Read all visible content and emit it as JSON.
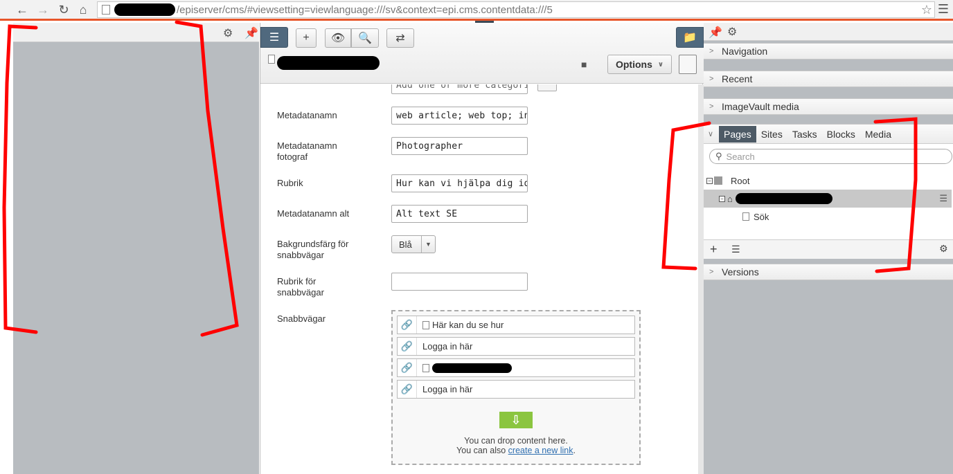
{
  "browser": {
    "url_text": "/episerver/cms/#viewsetting=viewlanguage:///sv&context=epi.cms.contentdata:///5",
    "back_icon": "arrow-left-icon",
    "forward_icon": "arrow-right-icon",
    "reload_icon": "reload-icon",
    "home_icon": "home-icon"
  },
  "left_pane": {
    "settings_icon": "gear-icon",
    "pin_icon": "pin-icon"
  },
  "editor": {
    "options_label": "Options",
    "form": {
      "category_placeholder": "Add one or more categories",
      "rows": [
        {
          "label": "Metadatanamn",
          "value": "web article; web top; ins"
        },
        {
          "label": "Metadatanamn fotograf",
          "value": "Photographer"
        },
        {
          "label": "Rubrik",
          "value": "Hur kan vi hjälpa dig idag"
        },
        {
          "label": "Metadatanamn alt",
          "value": "Alt text SE"
        },
        {
          "label": "Bakgrundsfärg för snabbvägar",
          "value": "Blå"
        },
        {
          "label": "Rubrik för snabbvägar",
          "value": ""
        },
        {
          "label": "Snabbvägar",
          "value": ""
        }
      ]
    },
    "links": [
      {
        "text": "Här kan du se hur",
        "has_page_icon": true
      },
      {
        "text": "Logga in här",
        "has_page_icon": false
      },
      {
        "text": "",
        "has_page_icon": true
      },
      {
        "text": "Logga in här",
        "has_page_icon": false
      }
    ],
    "drop_text_1": "You can drop content here.",
    "drop_text_2": "You can also",
    "drop_link": "create a new link",
    "drop_text_end": "."
  },
  "right_pane": {
    "sections": [
      "Navigation",
      "Recent",
      "ImageVault media"
    ],
    "tabs": [
      "Pages",
      "Sites",
      "Tasks",
      "Blocks",
      "Media"
    ],
    "active_tab": "Pages",
    "search_placeholder": "Search",
    "tree": {
      "root": "Root",
      "child": "Sök"
    },
    "versions_label": "Versions"
  },
  "colors": {
    "accent_bar": "#e8562a",
    "annotation": "#ff0000",
    "active_tab": "#4d5a66",
    "drop_arrow": "#8bc540"
  }
}
